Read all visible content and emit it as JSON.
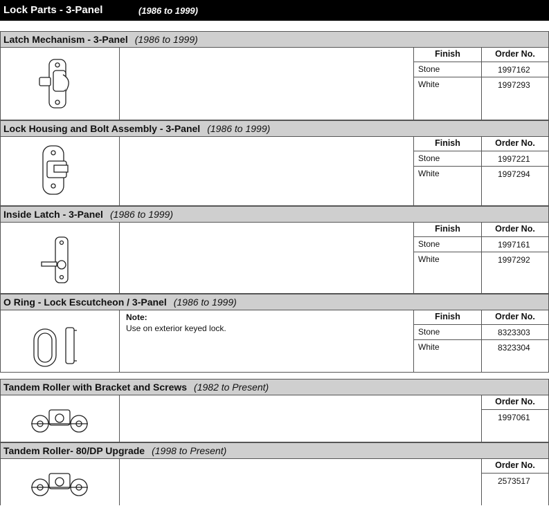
{
  "page": {
    "title": "Lock Parts - 3-Panel",
    "years": "(1986 to 1999)"
  },
  "sections": [
    {
      "name": "Latch Mechanism - 3-Panel",
      "years": "(1986 to 1999)",
      "finish_header": "Finish",
      "order_header": "Order No.",
      "rows": [
        {
          "finish": "Stone",
          "order": "1997162"
        },
        {
          "finish": "White",
          "order": "1997293"
        }
      ]
    },
    {
      "name": "Lock Housing and Bolt Assembly - 3-Panel",
      "years": "(1986 to 1999)",
      "finish_header": "Finish",
      "order_header": "Order No.",
      "rows": [
        {
          "finish": "Stone",
          "order": "1997221"
        },
        {
          "finish": "White",
          "order": "1997294"
        }
      ]
    },
    {
      "name": "Inside Latch - 3-Panel",
      "years": "(1986 to 1999)",
      "finish_header": "Finish",
      "order_header": "Order No.",
      "rows": [
        {
          "finish": "Stone",
          "order": "1997161"
        },
        {
          "finish": "White",
          "order": "1997292"
        }
      ]
    },
    {
      "name": "O Ring - Lock Escutcheon / 3-Panel",
      "years": "(1986 to 1999)",
      "note_label": "Note:",
      "note_text": "Use on exterior keyed lock.",
      "finish_header": "Finish",
      "order_header": "Order No.",
      "rows": [
        {
          "finish": "Stone",
          "order": "8323303"
        },
        {
          "finish": "White",
          "order": "8323304"
        }
      ]
    },
    {
      "name": "Tandem Roller with Bracket and Screws",
      "years": "(1982 to Present)",
      "order_header": "Order No.",
      "order": "1997061"
    },
    {
      "name": "Tandem Roller- 80/DP Upgrade",
      "years": "(1998 to Present)",
      "order_header": "Order No.",
      "order": "2573517"
    }
  ]
}
